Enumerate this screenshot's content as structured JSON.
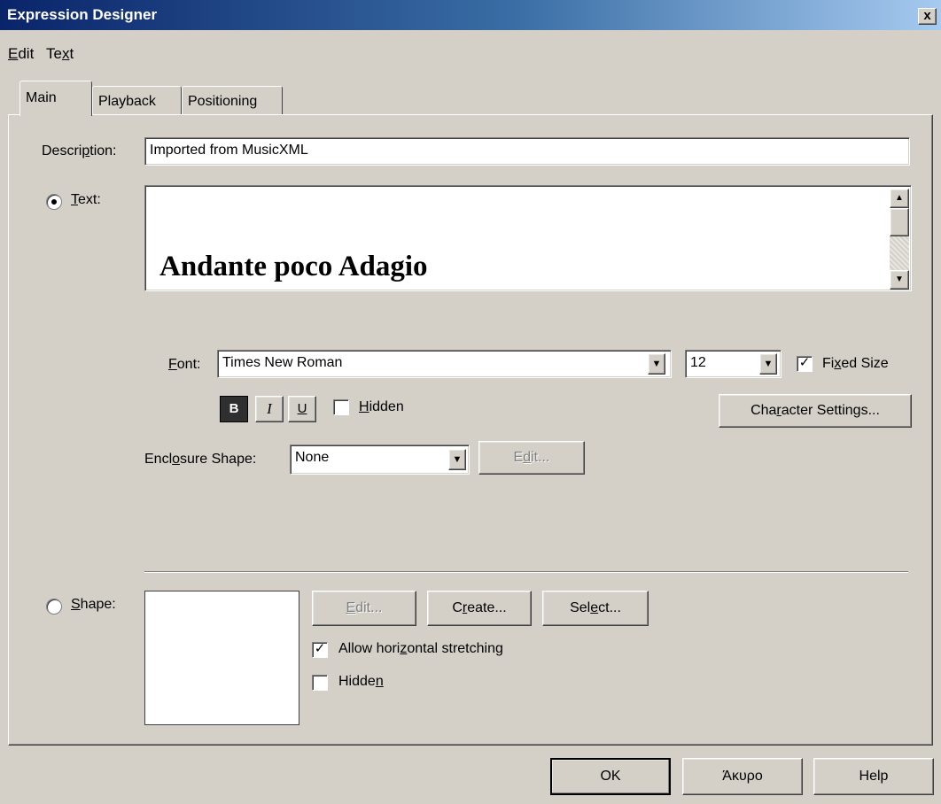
{
  "window": {
    "title": "Expression Designer",
    "close_glyph": "x"
  },
  "menu": [
    {
      "pre": "",
      "u": "E",
      "post": "dit"
    },
    {
      "pre": "Te",
      "u": "x",
      "post": "t"
    }
  ],
  "tabs": [
    "Main",
    "Playback",
    "Positioning"
  ],
  "main": {
    "description": {
      "pre": "Descri",
      "u": "p",
      "post": "tion:",
      "value": "Imported from MusicXML"
    },
    "text_radio": {
      "pre": "",
      "u": "T",
      "post": "ext:",
      "selected": true
    },
    "text_content": "Andante poco Adagio",
    "font": {
      "pre": "",
      "u": "F",
      "post": "ont:",
      "value": "Times New Roman",
      "size": "12"
    },
    "fixed_size": {
      "pre": "Fi",
      "u": "x",
      "post": "ed Size",
      "checked": true
    },
    "format_buttons": {
      "bold": "B",
      "italic": "I",
      "underline": "U"
    },
    "hidden": {
      "pre": "",
      "u": "H",
      "post": "idden",
      "checked": false
    },
    "character_settings": {
      "pre": "Cha",
      "u": "r",
      "post": "acter Settings..."
    },
    "enclosure": {
      "pre": "Encl",
      "u": "o",
      "post": "sure Shape:",
      "value": "None"
    },
    "enclosure_edit": {
      "pre": "E",
      "u": "d",
      "post": "it..."
    },
    "shape_radio": {
      "pre": "",
      "u": "S",
      "post": "hape:",
      "selected": false
    },
    "shape_edit": {
      "pre": "",
      "u": "E",
      "post": "dit..."
    },
    "create": {
      "pre": "C",
      "u": "r",
      "post": "eate..."
    },
    "select": {
      "pre": "Sel",
      "u": "e",
      "post": "ct..."
    },
    "allow_stretch": {
      "pre": "Allow hori",
      "u": "z",
      "post": "ontal stretching",
      "checked": true
    },
    "shape_hidden": {
      "pre": "Hidde",
      "u": "n",
      "post": "",
      "checked": false
    }
  },
  "footer": {
    "ok": "OK",
    "cancel": "Άκυρο",
    "help": "Help"
  },
  "colors": {
    "title_start": "#0a246a",
    "title_end": "#a6caf0",
    "face": "#d4d0c8"
  }
}
